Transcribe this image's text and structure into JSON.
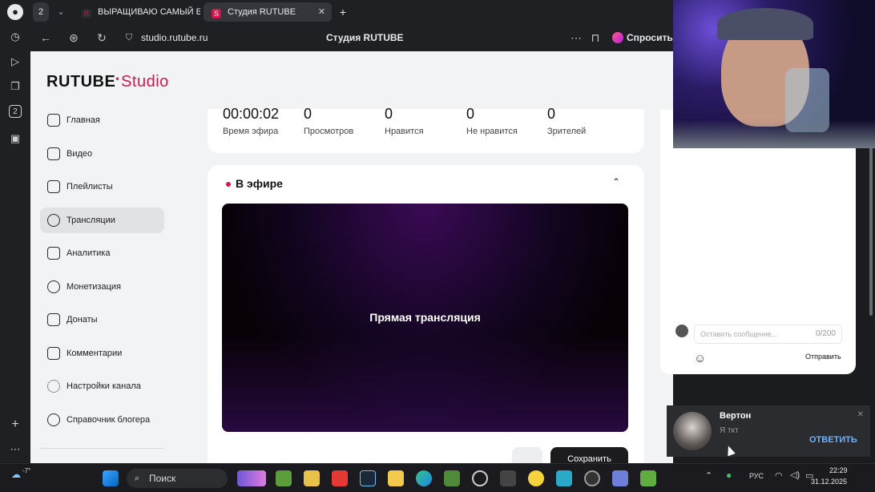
{
  "browser": {
    "tab_count_badge": "2",
    "tabs": [
      {
        "label": "ВЫРАЩИВАЮ САМЫЙ Б",
        "active": false
      },
      {
        "label": "Студия RUTUBE",
        "active": true
      }
    ],
    "url": "studio.rutube.ru",
    "page_title": "Студия RUTUBE",
    "ask_label": "Спросить",
    "rail_badge": "2"
  },
  "logo": {
    "brand": "RUTUBE",
    "product": "Studio"
  },
  "sidebar": {
    "items": [
      {
        "label": "Главная",
        "icon": "home-icon"
      },
      {
        "label": "Видео",
        "icon": "video-icon"
      },
      {
        "label": "Плейлисты",
        "icon": "playlist-icon"
      },
      {
        "label": "Трансляции",
        "icon": "broadcast-icon",
        "active": true
      },
      {
        "label": "Аналитика",
        "icon": "analytics-icon"
      },
      {
        "label": "Монетизация",
        "icon": "ruble-icon"
      },
      {
        "label": "Донаты",
        "icon": "wallet-icon"
      },
      {
        "label": "Комментарии",
        "icon": "comment-icon"
      },
      {
        "label": "Настройки канала",
        "icon": "gear-icon"
      },
      {
        "label": "Справочник блогера",
        "icon": "info-icon"
      }
    ]
  },
  "stats": [
    {
      "value": "00:00:02",
      "label": "Время эфира"
    },
    {
      "value": "0",
      "label": "Просмотров"
    },
    {
      "value": "0",
      "label": "Нравится"
    },
    {
      "value": "0",
      "label": "Не нравится"
    },
    {
      "value": "0",
      "label": "Зрителей"
    }
  ],
  "live": {
    "heading": "В эфире",
    "player_title": "Прямая трансляция",
    "save_button": "Сохранить"
  },
  "chat": {
    "placeholder": "Оставить сообщение...",
    "counter": "0/200",
    "send_label": "Отправить"
  },
  "toast": {
    "name": "Вертон",
    "message": "Я ткт",
    "action": "ОТВЕТИТЬ"
  },
  "taskbar": {
    "search_label": "Поиск",
    "weather": "-7°",
    "language": "РУС",
    "time": "22:29",
    "date": "31.12.2025"
  },
  "colors": {
    "accent": "#d3174e",
    "live_dot": "#d3174e",
    "toast_action": "#6db3ff"
  }
}
